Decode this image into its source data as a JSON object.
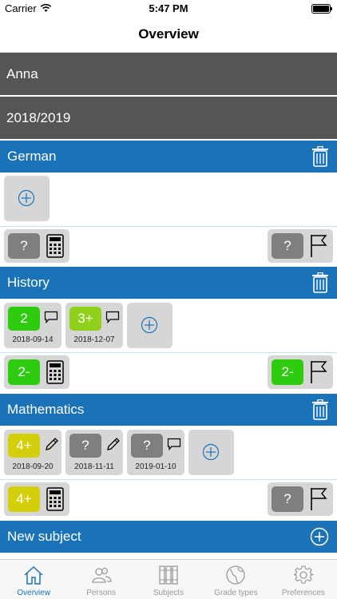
{
  "status_bar": {
    "carrier": "Carrier",
    "time": "5:47 PM"
  },
  "nav": {
    "title": "Overview"
  },
  "person": "Anna",
  "school_year": "2018/2019",
  "subjects": [
    {
      "name": "German",
      "grades": [],
      "average": "?",
      "final": "?"
    },
    {
      "name": "History",
      "grades": [
        {
          "value": "2",
          "date": "2018-09-14",
          "icon": "comment-icon"
        },
        {
          "value": "3+",
          "date": "2018-12-07",
          "icon": "comment-icon"
        }
      ],
      "average": "2-",
      "final": "2-"
    },
    {
      "name": "Mathematics",
      "grades": [
        {
          "value": "4+",
          "date": "2018-09-20",
          "icon": "pencil-icon"
        },
        {
          "value": "?",
          "date": "2018-11-11",
          "icon": "pencil-icon"
        },
        {
          "value": "?",
          "date": "2019-01-10",
          "icon": "comment-icon"
        }
      ],
      "average": "4+",
      "final": "?"
    }
  ],
  "new_subject": "New subject",
  "tabs": [
    {
      "label": "Overview",
      "icon": "home-icon",
      "active": true
    },
    {
      "label": "Persons",
      "icon": "persons-icon",
      "active": false
    },
    {
      "label": "Subjects",
      "icon": "binders-icon",
      "active": false
    },
    {
      "label": "Grade types",
      "icon": "globe-icon",
      "active": false
    },
    {
      "label": "Preferences",
      "icon": "gear-icon",
      "active": false
    }
  ],
  "colors": {
    "header_blue": "#1a73b8",
    "dark_gray_row": "#555555",
    "grade_green": "#2ecc0e",
    "grade_lime": "#8fd11a",
    "grade_yellow": "#d4cf0a",
    "grade_unknown": "#7f7f7f"
  }
}
